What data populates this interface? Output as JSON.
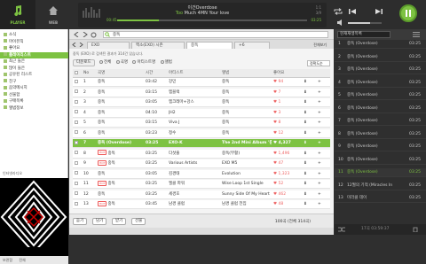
{
  "nav": {
    "player": "PLAYER",
    "web": "WEB"
  },
  "now_playing": {
    "title": "이건Overdose",
    "subtitle_accent": "Too",
    "subtitle_rest": "Much 4MN Your love",
    "elapsed": "00:45",
    "total": "03:25",
    "progress": 0.22,
    "meta_line1": "1:1",
    "meta_line2": "3/9"
  },
  "volume": 0.65,
  "sidebar": {
    "items": [
      {
        "label": "소식"
      },
      {
        "label": "마이뮤직"
      },
      {
        "label": "좋아요"
      },
      {
        "label": "플레이리스트",
        "selected": true
      },
      {
        "label": "최근 들은"
      },
      {
        "label": "많이 들은"
      },
      {
        "label": "공유된 리스트"
      },
      {
        "label": "친구"
      },
      {
        "label": "음악메시지"
      },
      {
        "label": "선물함"
      },
      {
        "label": "구매목록"
      },
      {
        "label": "앨범정보"
      }
    ],
    "section_label": "인터넷라디오",
    "bottom_label": "보관함",
    "bottom_label2": "전체"
  },
  "search": {
    "value": "중독"
  },
  "tabs": [
    {
      "label": "EXO"
    },
    {
      "label": "엑소(EXO) 시즌"
    },
    {
      "label": "중독",
      "active": true
    },
    {
      "label": "+6"
    }
  ],
  "tabs_right": "전체보기",
  "info_text": "중독 (EXO) 로 검색된 결과가 314건 있습니다.",
  "filters": {
    "button": "다운로드",
    "options": [
      "전체",
      "곡명",
      "아티스트명",
      "앨범"
    ],
    "sort": "정확도순"
  },
  "table": {
    "headers": [
      "No",
      "곡명",
      "시간",
      "아티스트",
      "앨범",
      "좋아요",
      "",
      ""
    ],
    "rows": [
      {
        "no": "1",
        "title": "중독",
        "time": "03:42",
        "artist": "강민",
        "album": "중독",
        "like": "♥ 94"
      },
      {
        "no": "2",
        "title": "중독",
        "time": "03:15",
        "artist": "엠블랙",
        "album": "중독",
        "like": "♥ 7"
      },
      {
        "no": "3",
        "title": "중독",
        "time": "03:05",
        "artist": "엠크레마+강스",
        "album": "중독",
        "like": "♥ 1"
      },
      {
        "no": "4",
        "title": "중독",
        "time": "04:10",
        "artist": "JH2",
        "album": "중독",
        "like": "♥ 3"
      },
      {
        "no": "5",
        "title": "중독",
        "time": "03:15",
        "artist": "Viva J",
        "album": "중독",
        "like": "♥ 8"
      },
      {
        "no": "6",
        "title": "중독",
        "time": "03:23",
        "artist": "정수",
        "album": "중독",
        "like": "♥ 12"
      },
      {
        "no": "7",
        "title": "중독 (Overdose)",
        "time": "03:25",
        "artist": "EXO-K",
        "album": "The 2nd Mini Album '중독...",
        "like": "♥ 4,327",
        "highlight": true
      },
      {
        "no": "8",
        "title": "중독",
        "time": "03:25",
        "artist": "다섯줄",
        "album": "중독(부활)",
        "like": "♥ 1,496",
        "hot": true
      },
      {
        "no": "9",
        "title": "중독",
        "time": "03:25",
        "artist": "Various Artists",
        "album": "EXO M5",
        "like": "♥ 47",
        "hot": true
      },
      {
        "no": "10",
        "title": "중독",
        "time": "03:05",
        "artist": "김경태",
        "album": "Evolution",
        "like": "♥ 1,323"
      },
      {
        "no": "11",
        "title": "중독",
        "time": "03:25",
        "artist": "엘클 파워",
        "album": "Wise Loop 1st Single",
        "like": "♥ 52",
        "hot": true
      },
      {
        "no": "12",
        "title": "중독",
        "time": "03:25",
        "artist": "세경호",
        "album": "Sunny Side Of My Heart",
        "like": "♥ 462"
      },
      {
        "no": "13",
        "title": "중독",
        "time": "03:45",
        "artist": "남경 클럽",
        "album": "남경 클럽 전집",
        "like": "♥ 48",
        "hot": true
      }
    ]
  },
  "bottom": {
    "buttons": [
      "듣기",
      "담기",
      "받기",
      "선물"
    ],
    "total": "100곡 (전체 314곡)"
  },
  "playlist": {
    "title": "현재재생목록",
    "items": [
      {
        "no": "1",
        "title": "중독 (Overdose)",
        "dur": "03:25"
      },
      {
        "no": "2",
        "title": "중독 (Overdose)",
        "dur": "03:25"
      },
      {
        "no": "3",
        "title": "중독 (Overdose)",
        "dur": "03:25"
      },
      {
        "no": "4",
        "title": "중독 (Overdose)",
        "dur": "03:25"
      },
      {
        "no": "5",
        "title": "중독 (Overdose)",
        "dur": "03:25"
      },
      {
        "no": "6",
        "title": "중독 (Overdose)",
        "dur": "03:25"
      },
      {
        "no": "7",
        "title": "중독 (Overdose)",
        "dur": "03:25"
      },
      {
        "no": "8",
        "title": "중독 (Overdose)",
        "dur": "03:25"
      },
      {
        "no": "9",
        "title": "중독 (Overdose)",
        "dur": "03:25"
      },
      {
        "no": "10",
        "title": "중독 (Overdose)",
        "dur": "03:25"
      },
      {
        "no": "11",
        "title": "중독 (Overdose)",
        "dur": "03:25",
        "current": true
      },
      {
        "no": "12",
        "title": "12월의 기적 (Miracles In",
        "dur": "03:25"
      },
      {
        "no": "13",
        "title": "미라클 데이",
        "dur": "03:25"
      }
    ],
    "footer": "17곡 03:59:37"
  },
  "colors": {
    "accent": "#7dc242",
    "dark_bg": "#2f2f2f"
  }
}
